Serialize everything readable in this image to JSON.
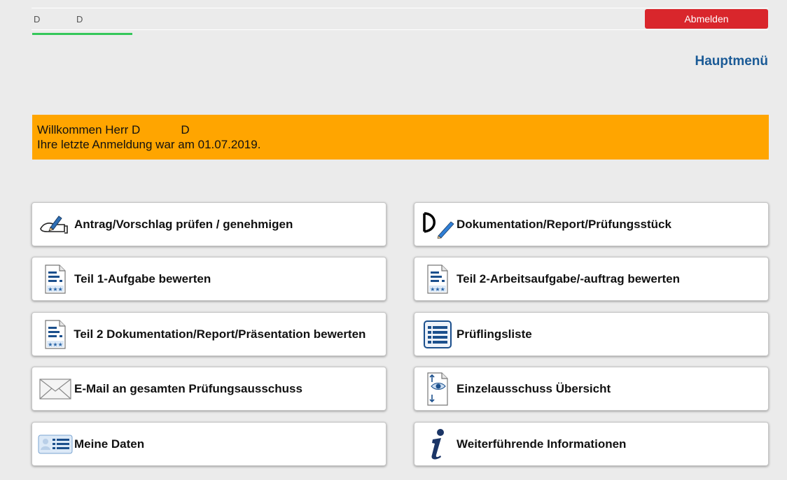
{
  "header": {
    "user_short_1": "D",
    "user_short_2": "D",
    "logout_label": "Abmelden"
  },
  "page_title": "Hauptmenü",
  "welcome": {
    "line1_prefix": "Willkommen Herr D",
    "line1_suffix": "D",
    "line2": "Ihre letzte Anmeldung war am 01.07.2019."
  },
  "menu": {
    "left": [
      {
        "label": "Antrag/Vorschlag prüfen / genehmigen",
        "icon": "pen-hand-icon"
      },
      {
        "label": "Teil 1-Aufgabe bewerten",
        "icon": "rated-document-icon"
      },
      {
        "label": "Teil 2 Dokumentation/Report/Präsentation bewerten",
        "icon": "rated-document-icon"
      },
      {
        "label": "E-Mail an gesamten Prüfungsausschuss",
        "icon": "envelope-icon"
      },
      {
        "label": "Meine Daten",
        "icon": "profile-card-icon"
      }
    ],
    "right": [
      {
        "label": "Dokumentation/Report/Prüfungsstück",
        "icon": "document-pencil-icon"
      },
      {
        "label": "Teil 2-Arbeitsaufgabe/-auftrag bewerten",
        "icon": "rated-document-icon"
      },
      {
        "label": "Prüflingsliste",
        "icon": "list-icon"
      },
      {
        "label": "Einzelausschuss Übersicht",
        "icon": "document-eye-icon"
      },
      {
        "label": "Weiterführende Informationen",
        "icon": "info-icon"
      }
    ]
  },
  "colors": {
    "accent_blue": "#1a5a96",
    "logout_red": "#d9262c",
    "welcome_orange": "#ffa500",
    "active_green": "#34c75a"
  }
}
